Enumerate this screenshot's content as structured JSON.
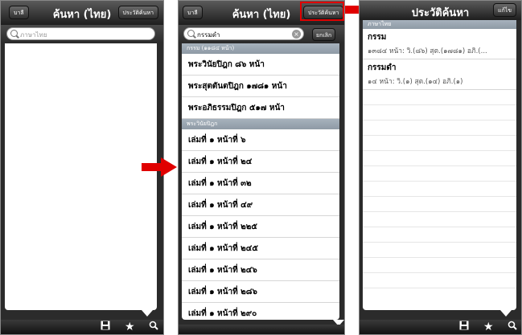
{
  "screen1": {
    "title": "ค้นหา (ไทย)",
    "left_button": "บาลี",
    "right_button": "ประวัติค้นหา",
    "search_placeholder": "ภาษาไทย"
  },
  "screen2": {
    "title": "ค้นหา (ไทย)",
    "left_button": "บาลี",
    "right_button": "ประวัติค้นหา",
    "search_value": "กรรมดำ",
    "cancel_label": "ยกเลิก",
    "section1_header": "กรรม (๑๑๘๔ หน้า)",
    "section1_rows": [
      "พระวินัยปิฎก ๘๖ หน้า",
      "พระสุตตันตปิฎก ๑๗๘๑ หน้า",
      "พระอภิธรรมปิฎก ๕๑๗ หน้า"
    ],
    "section2_header": "พระวินัยปิฎก",
    "section2_rows": [
      "เล่มที่ ๑ หน้าที่ ๖",
      "เล่มที่ ๑ หน้าที่ ๒๔",
      "เล่มที่ ๑ หน้าที่ ๓๒",
      "เล่มที่ ๑ หน้าที่ ๔๙",
      "เล่มที่ ๑ หน้าที่ ๒๒๕",
      "เล่มที่ ๑ หน้าที่ ๒๔๕",
      "เล่มที่ ๑ หน้าที่ ๒๔๖",
      "เล่มที่ ๑ หน้าที่ ๒๘๖",
      "เล่มที่ ๑ หน้าที่ ๒๙๐"
    ]
  },
  "screen3": {
    "title": "ประวัติค้นหา",
    "right_button": "แก้ไข",
    "section_header": "ภาษาไทย",
    "items": [
      {
        "term": "กรรม",
        "detail": "๑๓๘๔ หน้า: วิ.(๘๖) สุต.(๑๗๘๑) อภิ.(..."
      },
      {
        "term": "กรรมดำ",
        "detail": "๑๔ หน้า: วิ.(๑) สุต.(๑๔) อภิ.(๑)"
      }
    ]
  },
  "icons": [
    "save-icon",
    "star-icon",
    "search-icon"
  ],
  "colors": {
    "annotation_red": "#e00000",
    "nav_dark": "#2b2b2b",
    "section_header": "#9aa6b1"
  }
}
